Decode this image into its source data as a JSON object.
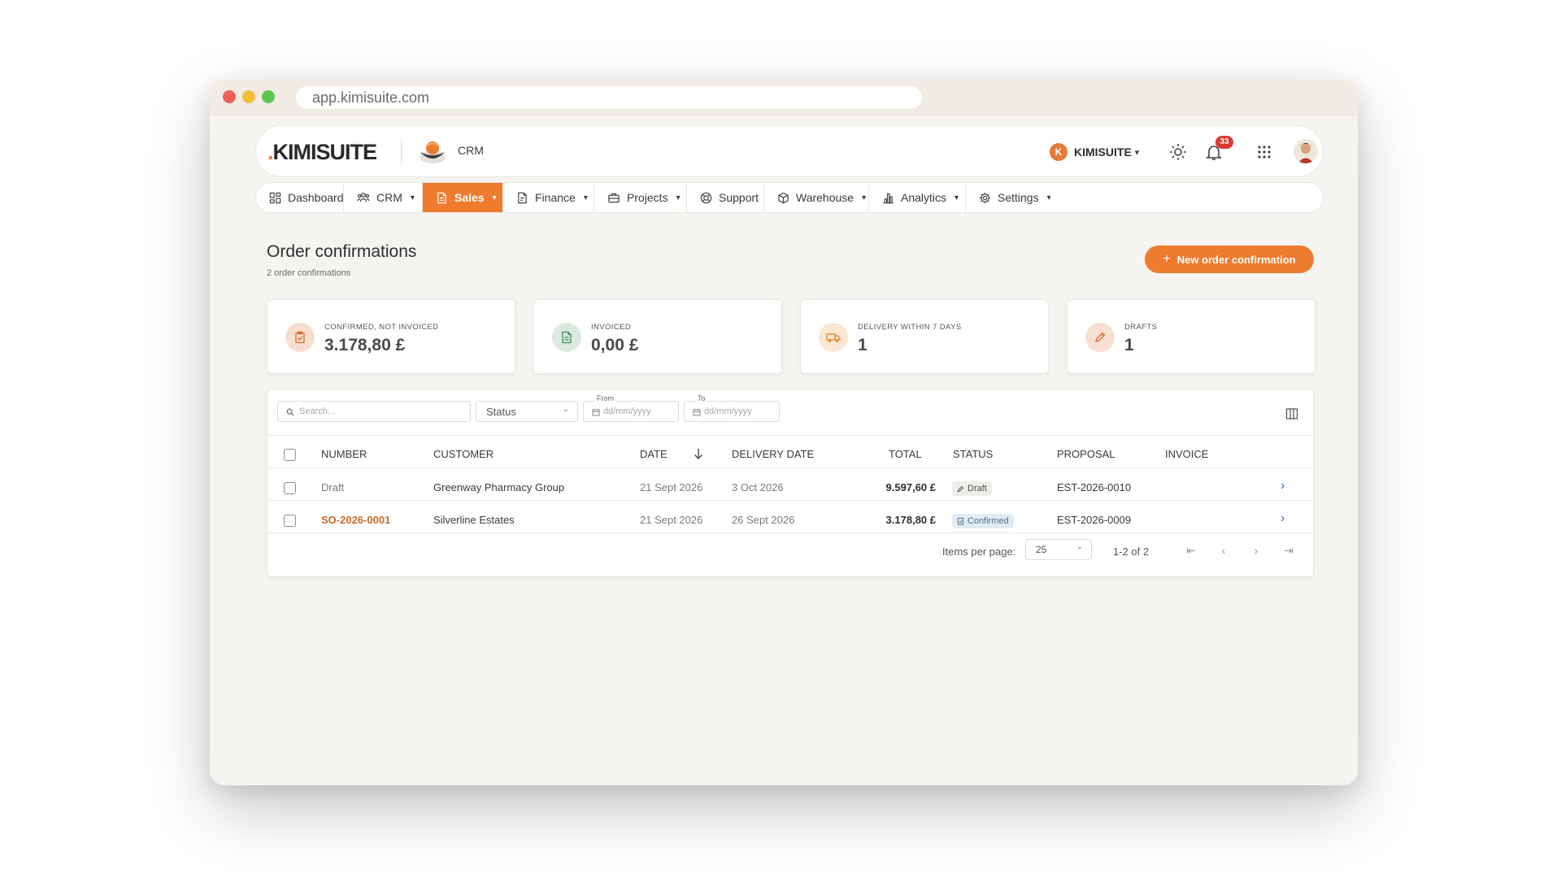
{
  "browser": {
    "url": "app.kimisuite.com"
  },
  "header": {
    "logo": "KIMISUITE",
    "app_label": "CRM",
    "company_initial": "K",
    "company_name": "KIMISUITE",
    "notification_count": "33"
  },
  "nav": {
    "items": [
      {
        "label": "Dashboard",
        "icon": "dashboard-icon",
        "has_caret": false
      },
      {
        "label": "CRM",
        "icon": "users-icon",
        "has_caret": true
      },
      {
        "label": "Sales",
        "icon": "document-icon",
        "has_caret": true,
        "active": true
      },
      {
        "label": "Finance",
        "icon": "file-icon",
        "has_caret": true
      },
      {
        "label": "Projects",
        "icon": "briefcase-icon",
        "has_caret": true
      },
      {
        "label": "Support",
        "icon": "lifebuoy-icon",
        "has_caret": false
      },
      {
        "label": "Warehouse",
        "icon": "box-icon",
        "has_caret": true
      },
      {
        "label": "Analytics",
        "icon": "bar-chart-icon",
        "has_caret": true
      },
      {
        "label": "Settings",
        "icon": "gear-icon",
        "has_caret": true
      }
    ]
  },
  "page": {
    "title": "Order confirmations",
    "subtitle": "2 order confirmations",
    "new_button": "New order confirmation"
  },
  "kpis": [
    {
      "label": "CONFIRMED, NOT INVOICED",
      "value": "3.178,80 £",
      "icon": "clipboard-check-icon",
      "color": "#f6dfd0"
    },
    {
      "label": "INVOICED",
      "value": "0,00 £",
      "icon": "invoice-icon",
      "color": "#dbe9df"
    },
    {
      "label": "DELIVERY WITHIN 7 DAYS",
      "value": "1",
      "icon": "truck-icon",
      "color": "#f8e7d2"
    },
    {
      "label": "DRAFTS",
      "value": "1",
      "icon": "pencil-icon",
      "color": "#f7dfd2"
    }
  ],
  "filters": {
    "search_placeholder": "Search...",
    "status_label": "Status",
    "from_label": "From",
    "from_placeholder": "dd/mm/yyyy",
    "to_label": "To",
    "to_placeholder": "dd/mm/yyyy"
  },
  "table": {
    "columns": [
      "NUMBER",
      "CUSTOMER",
      "DATE",
      "DELIVERY DATE",
      "TOTAL",
      "STATUS",
      "PROPOSAL",
      "INVOICE"
    ],
    "rows": [
      {
        "number": "Draft",
        "customer": "Greenway Pharmacy Group",
        "date": "21 Sept 2026",
        "delivery": "3 Oct 2026",
        "total": "9.597,60 £",
        "status": "Draft",
        "proposal": "EST-2026-0010",
        "invoice": ""
      },
      {
        "number": "SO-2026-0001",
        "customer": "Silverline Estates",
        "date": "21 Sept 2026",
        "delivery": "26 Sept 2026",
        "total": "3.178,80 £",
        "status": "Confirmed",
        "proposal": "EST-2026-0009",
        "invoice": ""
      }
    ]
  },
  "pagination": {
    "items_per_page_label": "Items per page:",
    "items_per_page": "25",
    "range": "1-2 of 2"
  },
  "colors": {
    "accent": "#ef7b2f",
    "link": "#c9692a"
  }
}
